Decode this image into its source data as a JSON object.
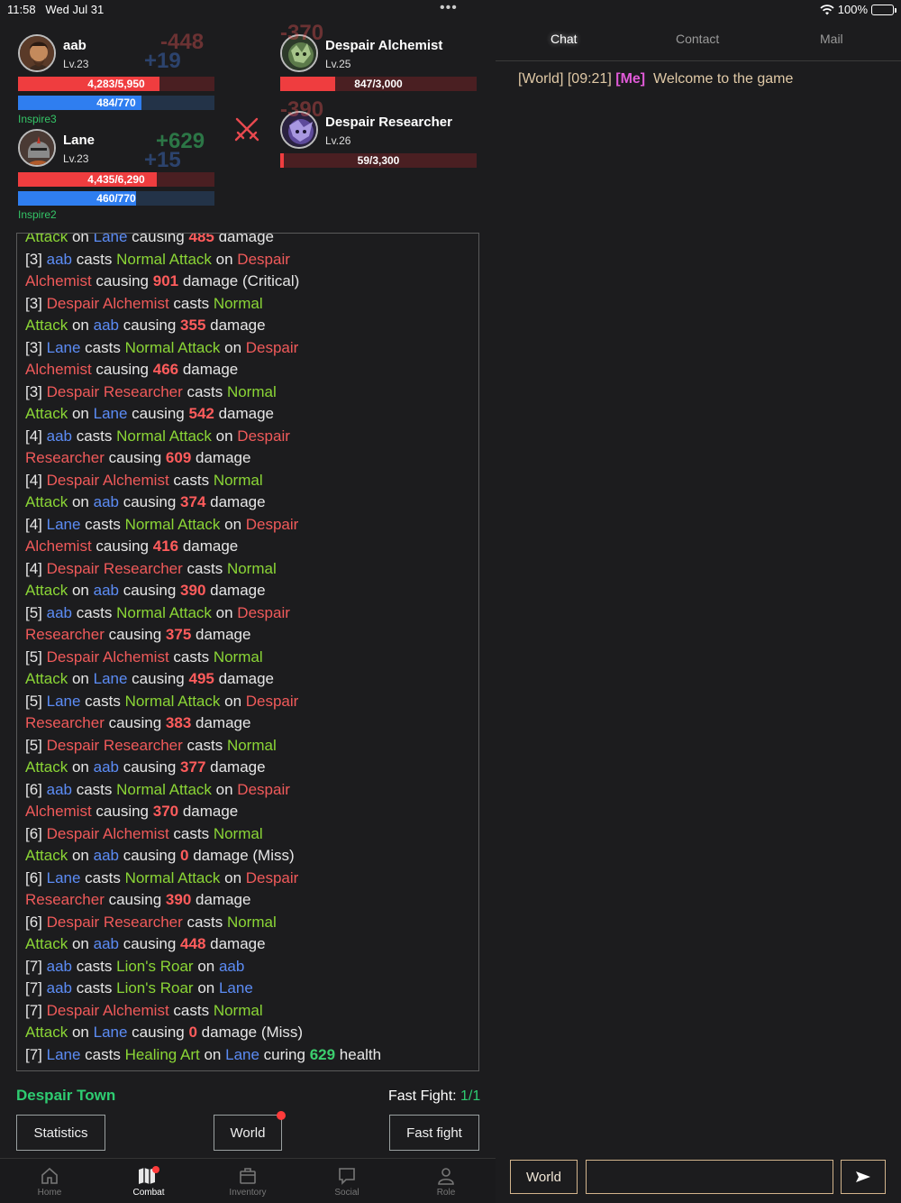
{
  "status_bar": {
    "time": "11:58",
    "date": "Wed Jul 31",
    "dots": "•••",
    "battery": "100%"
  },
  "party": [
    {
      "name": "aab",
      "level": "Lv.23",
      "hp_text": "4,283/5,950",
      "hp_frac": 0.72,
      "mp_text": "484/770",
      "mp_frac": 0.63,
      "float_dmg": "-448",
      "float_mp": "+19",
      "buff": "Inspire3"
    },
    {
      "name": "Lane",
      "level": "Lv.23",
      "hp_text": "4,435/6,290",
      "hp_frac": 0.705,
      "mp_text": "460/770",
      "mp_frac": 0.6,
      "float_heal": "+629",
      "float_mp": "+15",
      "buff": "Inspire2"
    }
  ],
  "enemies": [
    {
      "name": "Despair Alchemist",
      "level": "Lv.25",
      "hp_text": "847/3,000",
      "hp_frac": 0.28,
      "float_dmg": "-370"
    },
    {
      "name": "Despair Researcher",
      "level": "Lv.26",
      "hp_text": "59/3,300",
      "hp_frac": 0.018,
      "float_dmg": "-390"
    }
  ],
  "log_lines": [
    [
      [
        "g",
        "Attack"
      ],
      [
        "t",
        " on "
      ],
      [
        "b",
        "Lane"
      ],
      [
        "t",
        " causing "
      ],
      [
        "d",
        "485"
      ],
      [
        "t",
        " damage"
      ]
    ],
    [
      [
        "t",
        "[3]  "
      ],
      [
        "b",
        "aab"
      ],
      [
        "t",
        " casts "
      ],
      [
        "g",
        "Normal Attack"
      ],
      [
        "t",
        " on "
      ],
      [
        "r",
        "Despair"
      ]
    ],
    [
      [
        "r",
        "Alchemist"
      ],
      [
        "t",
        " causing "
      ],
      [
        "d",
        "901"
      ],
      [
        "t",
        " damage (Critical)"
      ]
    ],
    [
      [
        "t",
        "[3]  "
      ],
      [
        "r",
        "Despair Alchemist"
      ],
      [
        "t",
        " casts "
      ],
      [
        "g",
        "Normal"
      ]
    ],
    [
      [
        "g",
        "Attack"
      ],
      [
        "t",
        " on "
      ],
      [
        "b",
        "aab"
      ],
      [
        "t",
        " causing "
      ],
      [
        "d",
        "355"
      ],
      [
        "t",
        " damage"
      ]
    ],
    [
      [
        "t",
        "[3]  "
      ],
      [
        "b",
        "Lane"
      ],
      [
        "t",
        " casts "
      ],
      [
        "g",
        "Normal Attack"
      ],
      [
        "t",
        " on "
      ],
      [
        "r",
        "Despair"
      ]
    ],
    [
      [
        "r",
        "Alchemist"
      ],
      [
        "t",
        " causing "
      ],
      [
        "d",
        "466"
      ],
      [
        "t",
        " damage"
      ]
    ],
    [
      [
        "t",
        "[3]  "
      ],
      [
        "r",
        "Despair Researcher"
      ],
      [
        "t",
        " casts "
      ],
      [
        "g",
        "Normal"
      ]
    ],
    [
      [
        "g",
        "Attack"
      ],
      [
        "t",
        " on "
      ],
      [
        "b",
        "Lane"
      ],
      [
        "t",
        " causing "
      ],
      [
        "d",
        "542"
      ],
      [
        "t",
        " damage"
      ]
    ],
    [
      [
        "t",
        "[4]  "
      ],
      [
        "b",
        "aab"
      ],
      [
        "t",
        " casts "
      ],
      [
        "g",
        "Normal Attack"
      ],
      [
        "t",
        " on "
      ],
      [
        "r",
        "Despair"
      ]
    ],
    [
      [
        "r",
        "Researcher"
      ],
      [
        "t",
        " causing "
      ],
      [
        "d",
        "609"
      ],
      [
        "t",
        " damage"
      ]
    ],
    [
      [
        "t",
        "[4]  "
      ],
      [
        "r",
        "Despair Alchemist"
      ],
      [
        "t",
        " casts "
      ],
      [
        "g",
        "Normal"
      ]
    ],
    [
      [
        "g",
        "Attack"
      ],
      [
        "t",
        " on "
      ],
      [
        "b",
        "aab"
      ],
      [
        "t",
        " causing "
      ],
      [
        "d",
        "374"
      ],
      [
        "t",
        " damage"
      ]
    ],
    [
      [
        "t",
        "[4]  "
      ],
      [
        "b",
        "Lane"
      ],
      [
        "t",
        " casts "
      ],
      [
        "g",
        "Normal Attack"
      ],
      [
        "t",
        " on "
      ],
      [
        "r",
        "Despair"
      ]
    ],
    [
      [
        "r",
        "Alchemist"
      ],
      [
        "t",
        " causing "
      ],
      [
        "d",
        "416"
      ],
      [
        "t",
        " damage"
      ]
    ],
    [
      [
        "t",
        "[4]  "
      ],
      [
        "r",
        "Despair Researcher"
      ],
      [
        "t",
        " casts "
      ],
      [
        "g",
        "Normal"
      ]
    ],
    [
      [
        "g",
        "Attack"
      ],
      [
        "t",
        " on "
      ],
      [
        "b",
        "aab"
      ],
      [
        "t",
        " causing "
      ],
      [
        "d",
        "390"
      ],
      [
        "t",
        " damage"
      ]
    ],
    [
      [
        "t",
        "[5]  "
      ],
      [
        "b",
        "aab"
      ],
      [
        "t",
        " casts "
      ],
      [
        "g",
        "Normal Attack"
      ],
      [
        "t",
        " on "
      ],
      [
        "r",
        "Despair"
      ]
    ],
    [
      [
        "r",
        "Researcher"
      ],
      [
        "t",
        " causing "
      ],
      [
        "d",
        "375"
      ],
      [
        "t",
        " damage"
      ]
    ],
    [
      [
        "t",
        "[5]  "
      ],
      [
        "r",
        "Despair Alchemist"
      ],
      [
        "t",
        " casts "
      ],
      [
        "g",
        "Normal"
      ]
    ],
    [
      [
        "g",
        "Attack"
      ],
      [
        "t",
        " on "
      ],
      [
        "b",
        "Lane"
      ],
      [
        "t",
        " causing "
      ],
      [
        "d",
        "495"
      ],
      [
        "t",
        " damage"
      ]
    ],
    [
      [
        "t",
        "[5]  "
      ],
      [
        "b",
        "Lane"
      ],
      [
        "t",
        " casts "
      ],
      [
        "g",
        "Normal Attack"
      ],
      [
        "t",
        " on "
      ],
      [
        "r",
        "Despair"
      ]
    ],
    [
      [
        "r",
        "Researcher"
      ],
      [
        "t",
        " causing "
      ],
      [
        "d",
        "383"
      ],
      [
        "t",
        " damage"
      ]
    ],
    [
      [
        "t",
        "[5]  "
      ],
      [
        "r",
        "Despair Researcher"
      ],
      [
        "t",
        " casts "
      ],
      [
        "g",
        "Normal"
      ]
    ],
    [
      [
        "g",
        "Attack"
      ],
      [
        "t",
        " on "
      ],
      [
        "b",
        "aab"
      ],
      [
        "t",
        " causing "
      ],
      [
        "d",
        "377"
      ],
      [
        "t",
        " damage"
      ]
    ],
    [
      [
        "t",
        "[6]  "
      ],
      [
        "b",
        "aab"
      ],
      [
        "t",
        " casts "
      ],
      [
        "g",
        "Normal Attack"
      ],
      [
        "t",
        " on "
      ],
      [
        "r",
        "Despair"
      ]
    ],
    [
      [
        "r",
        "Alchemist"
      ],
      [
        "t",
        " causing "
      ],
      [
        "d",
        "370"
      ],
      [
        "t",
        " damage"
      ]
    ],
    [
      [
        "t",
        "[6]  "
      ],
      [
        "r",
        "Despair Alchemist"
      ],
      [
        "t",
        " casts "
      ],
      [
        "g",
        "Normal"
      ]
    ],
    [
      [
        "g",
        "Attack"
      ],
      [
        "t",
        " on "
      ],
      [
        "b",
        "aab"
      ],
      [
        "t",
        " causing "
      ],
      [
        "d",
        "0"
      ],
      [
        "t",
        " damage (Miss)"
      ]
    ],
    [
      [
        "t",
        "[6]  "
      ],
      [
        "b",
        "Lane"
      ],
      [
        "t",
        " casts "
      ],
      [
        "g",
        "Normal Attack"
      ],
      [
        "t",
        " on "
      ],
      [
        "r",
        "Despair"
      ]
    ],
    [
      [
        "r",
        "Researcher"
      ],
      [
        "t",
        " causing "
      ],
      [
        "d",
        "390"
      ],
      [
        "t",
        " damage"
      ]
    ],
    [
      [
        "t",
        "[6]  "
      ],
      [
        "r",
        "Despair Researcher"
      ],
      [
        "t",
        " casts "
      ],
      [
        "g",
        "Normal"
      ]
    ],
    [
      [
        "g",
        "Attack"
      ],
      [
        "t",
        " on "
      ],
      [
        "b",
        "aab"
      ],
      [
        "t",
        " causing "
      ],
      [
        "d",
        "448"
      ],
      [
        "t",
        " damage"
      ]
    ],
    [
      [
        "t",
        "[7]  "
      ],
      [
        "b",
        "aab"
      ],
      [
        "t",
        " casts "
      ],
      [
        "g",
        "Lion's Roar"
      ],
      [
        "t",
        " on "
      ],
      [
        "b",
        "aab"
      ]
    ],
    [
      [
        "t",
        "[7]  "
      ],
      [
        "b",
        "aab"
      ],
      [
        "t",
        " casts "
      ],
      [
        "g",
        "Lion's Roar"
      ],
      [
        "t",
        " on "
      ],
      [
        "b",
        "Lane"
      ]
    ],
    [
      [
        "t",
        "[7]  "
      ],
      [
        "r",
        "Despair Alchemist"
      ],
      [
        "t",
        " casts "
      ],
      [
        "g",
        "Normal"
      ]
    ],
    [
      [
        "g",
        "Attack"
      ],
      [
        "t",
        " on "
      ],
      [
        "b",
        "Lane"
      ],
      [
        "t",
        " causing "
      ],
      [
        "d",
        "0"
      ],
      [
        "t",
        " damage (Miss)"
      ]
    ],
    [
      [
        "t",
        "[7]  "
      ],
      [
        "b",
        "Lane"
      ],
      [
        "t",
        " casts "
      ],
      [
        "g",
        "Healing Art"
      ],
      [
        "t",
        " on "
      ],
      [
        "b",
        "Lane"
      ],
      [
        "t",
        " curing "
      ],
      [
        "h",
        "629"
      ],
      [
        "t",
        " health"
      ]
    ]
  ],
  "location": "Despair Town",
  "fast_fight": {
    "label": "Fast Fight: ",
    "value": "1/1"
  },
  "buttons": {
    "statistics": "Statistics",
    "world": "World",
    "fast_fight": "Fast fight"
  },
  "tabbar": [
    {
      "id": "home",
      "label": "Home"
    },
    {
      "id": "combat",
      "label": "Combat"
    },
    {
      "id": "inventory",
      "label": "Inventory"
    },
    {
      "id": "social",
      "label": "Social"
    },
    {
      "id": "role",
      "label": "Role"
    }
  ],
  "chat": {
    "tabs": [
      "Chat",
      "Contact",
      "Mail"
    ],
    "message": {
      "channel": "[World]",
      "time": "[09:21]",
      "sender": "[Me]",
      "text": "Welcome to the game"
    },
    "channel_button": "World",
    "input_value": ""
  }
}
